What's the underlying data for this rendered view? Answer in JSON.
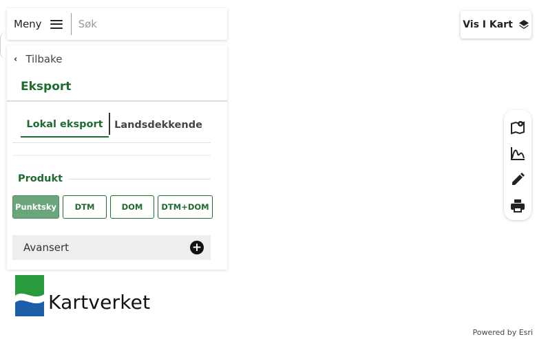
{
  "topbar": {
    "menu_label": "Meny",
    "search_placeholder": "Søk"
  },
  "panel": {
    "back_label": "Tilbake",
    "title": "Eksport",
    "tabs": [
      {
        "label": "Lokal eksport",
        "active": true
      },
      {
        "label": "Landsdekkende",
        "active": false
      }
    ],
    "product_heading": "Produkt",
    "products": [
      {
        "label": "Punktsky",
        "active": true
      },
      {
        "label": "DTM",
        "active": false
      },
      {
        "label": "DOM",
        "active": false
      },
      {
        "label": "DTM+DOM",
        "active": false
      }
    ],
    "advanced_label": "Avansert"
  },
  "logo": {
    "text": "Kartverket"
  },
  "map_controls": {
    "layers_label": "Vis I Kart",
    "tools": [
      "map-pin-icon",
      "profile-graph-icon",
      "pencil-icon",
      "print-icon"
    ]
  },
  "attribution": "Powered by Esri",
  "colors": {
    "accent_green": "#1e6b30",
    "active_button": "#6aa57c",
    "logo_green": "#2a9a3e",
    "logo_blue": "#1b5fa8"
  }
}
